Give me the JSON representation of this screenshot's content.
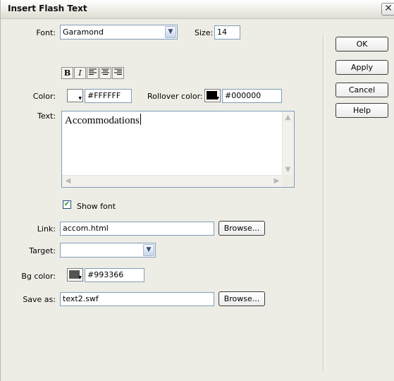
{
  "window": {
    "title": "Insert Flash Text",
    "close_glyph": "✕"
  },
  "font": {
    "label": "Font:",
    "value": "Garamond",
    "size_label": "Size:",
    "size_value": "14"
  },
  "format": {
    "bold": "B",
    "italic": "I",
    "align_left_icon": "align-left-icon",
    "align_center_icon": "align-center-icon",
    "align_right_icon": "align-right-icon"
  },
  "color": {
    "label": "Color:",
    "value": "#FFFFFF",
    "swatch": "#FFFFFF",
    "rollover_label": "Rollover color:",
    "rollover_value": "#000000",
    "rollover_swatch": "#000000"
  },
  "text": {
    "label": "Text:",
    "value": "Accommodations"
  },
  "show_font": {
    "label": "Show font",
    "checked": true
  },
  "link": {
    "label": "Link:",
    "value": "accom.html",
    "browse": "Browse..."
  },
  "target": {
    "label": "Target:",
    "value": ""
  },
  "bg_color": {
    "label": "Bg color:",
    "value": "#993366",
    "swatch": "#555555"
  },
  "save_as": {
    "label": "Save as:",
    "value": "text2.swf",
    "browse": "Browse..."
  },
  "buttons": {
    "ok": "OK",
    "apply": "Apply",
    "cancel": "Cancel",
    "help": "Help"
  }
}
